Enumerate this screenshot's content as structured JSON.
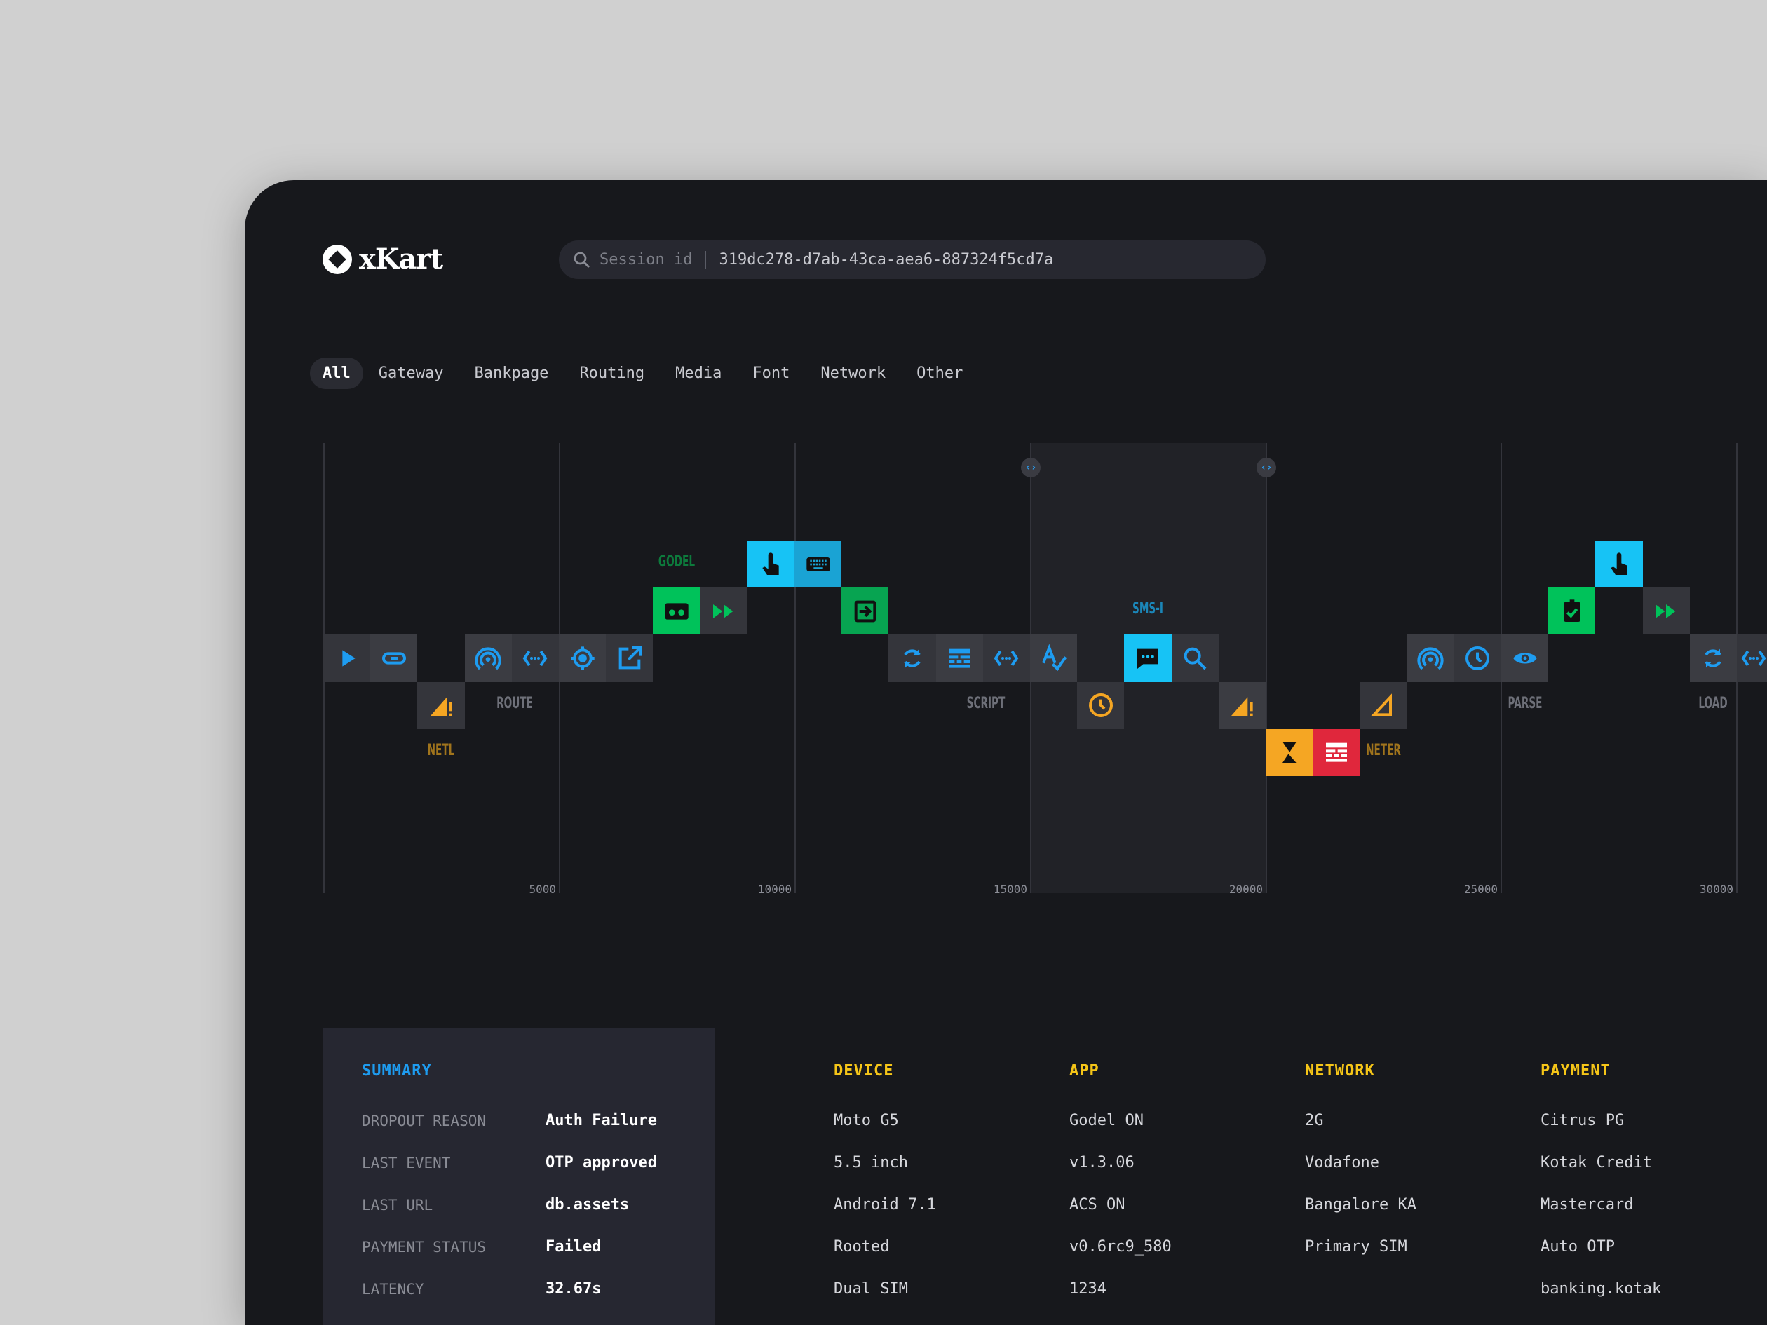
{
  "app": {
    "logo_text": "xKart"
  },
  "search": {
    "placeholder": "Session id",
    "value": "319dc278-d7ab-43ca-aea6-887324f5cd7a",
    "icon": "search-icon"
  },
  "tabs": [
    {
      "label": "All",
      "active": true
    },
    {
      "label": "Gateway"
    },
    {
      "label": "Bankpage"
    },
    {
      "label": "Routing"
    },
    {
      "label": "Media"
    },
    {
      "label": "Font"
    },
    {
      "label": "Network"
    },
    {
      "label": "Other"
    }
  ],
  "colors": {
    "blue": "#1e9cf0",
    "cyan": "#17c3f5",
    "cyan_dark": "#1aa3d4",
    "green": "#00c25a",
    "green_dark": "#07a451",
    "orange": "#f5a623",
    "red": "#e0273c",
    "gray": "#34353b",
    "gray_light": "#3b3c42",
    "summary_heading": "#1e9cf0",
    "section_heading": "#f5c518"
  },
  "timeline": {
    "ticks": [
      "5000",
      "10000",
      "15000",
      "20000",
      "25000",
      "30000"
    ],
    "selection_handles": [
      "handle-left",
      "handle-right"
    ],
    "events": [
      {
        "icon": "play",
        "tone": "gray"
      },
      {
        "icon": "link",
        "tone": "gray"
      },
      {
        "icon": "warning",
        "tone": "gray-orange"
      },
      {
        "icon": "broadcast",
        "tone": "gray"
      },
      {
        "icon": "code",
        "tone": "gray"
      },
      {
        "icon": "target",
        "tone": "gray"
      },
      {
        "icon": "external-link",
        "tone": "gray"
      },
      {
        "icon": "cassette",
        "tone": "green"
      },
      {
        "icon": "fast-forward",
        "tone": "gray-green"
      },
      {
        "icon": "touch",
        "tone": "cyan"
      },
      {
        "icon": "keyboard",
        "tone": "cyan-dark"
      },
      {
        "icon": "login",
        "tone": "green-dark"
      },
      {
        "icon": "refresh",
        "tone": "gray"
      },
      {
        "icon": "table",
        "tone": "gray"
      },
      {
        "icon": "code",
        "tone": "gray"
      },
      {
        "icon": "spellcheck",
        "tone": "gray"
      },
      {
        "icon": "clock",
        "tone": "gray-orange"
      },
      {
        "icon": "chat",
        "tone": "cyan"
      },
      {
        "icon": "search",
        "tone": "gray"
      },
      {
        "icon": "warning",
        "tone": "gray-orange"
      },
      {
        "icon": "hourglass-off",
        "tone": "orange"
      },
      {
        "icon": "table",
        "tone": "red"
      },
      {
        "icon": "triangle-outline",
        "tone": "gray-orange"
      },
      {
        "icon": "broadcast",
        "tone": "gray"
      },
      {
        "icon": "clock",
        "tone": "gray"
      },
      {
        "icon": "eye",
        "tone": "gray"
      },
      {
        "icon": "clipboard-check",
        "tone": "green"
      },
      {
        "icon": "touch",
        "tone": "cyan"
      },
      {
        "icon": "fast-forward",
        "tone": "gray-green"
      },
      {
        "icon": "refresh",
        "tone": "gray"
      },
      {
        "icon": "code",
        "tone": "gray"
      }
    ],
    "labels": [
      {
        "text": "NETL",
        "color": "#a0741c"
      },
      {
        "text": "ROUTE",
        "color": "#6e7079"
      },
      {
        "text": "GODEL",
        "color": "#0d7a3c"
      },
      {
        "text": "SCRIPT",
        "color": "#6e7079"
      },
      {
        "text": "SMS-I",
        "color": "#1b86b8"
      },
      {
        "text": "NETER",
        "color": "#a0741c"
      },
      {
        "text": "PARSE",
        "color": "#6e7079"
      },
      {
        "text": "LOAD",
        "color": "#6e7079"
      }
    ]
  },
  "summary": {
    "title": "SUMMARY",
    "rows": [
      {
        "label": "DROPOUT REASON",
        "value": "Auth Failure"
      },
      {
        "label": "LAST EVENT",
        "value": "OTP approved"
      },
      {
        "label": "LAST URL",
        "value": "db.assets"
      },
      {
        "label": "PAYMENT STATUS",
        "value": "Failed"
      },
      {
        "label": "LATENCY",
        "value": "32.67s"
      }
    ]
  },
  "sections": [
    {
      "title": "DEVICE",
      "items": [
        "Moto G5",
        "5.5 inch",
        "Android 7.1",
        "Rooted",
        "Dual SIM"
      ]
    },
    {
      "title": "APP",
      "items": [
        "Godel ON",
        "v1.3.06",
        "ACS ON",
        "v0.6rc9_580",
        "1234"
      ]
    },
    {
      "title": "NETWORK",
      "items": [
        "2G",
        "Vodafone",
        "Bangalore KA",
        "Primary SIM"
      ]
    },
    {
      "title": "PAYMENT",
      "items": [
        "Citrus PG",
        "Kotak Credit",
        "Mastercard",
        "Auto OTP",
        "banking.kotak"
      ]
    }
  ]
}
